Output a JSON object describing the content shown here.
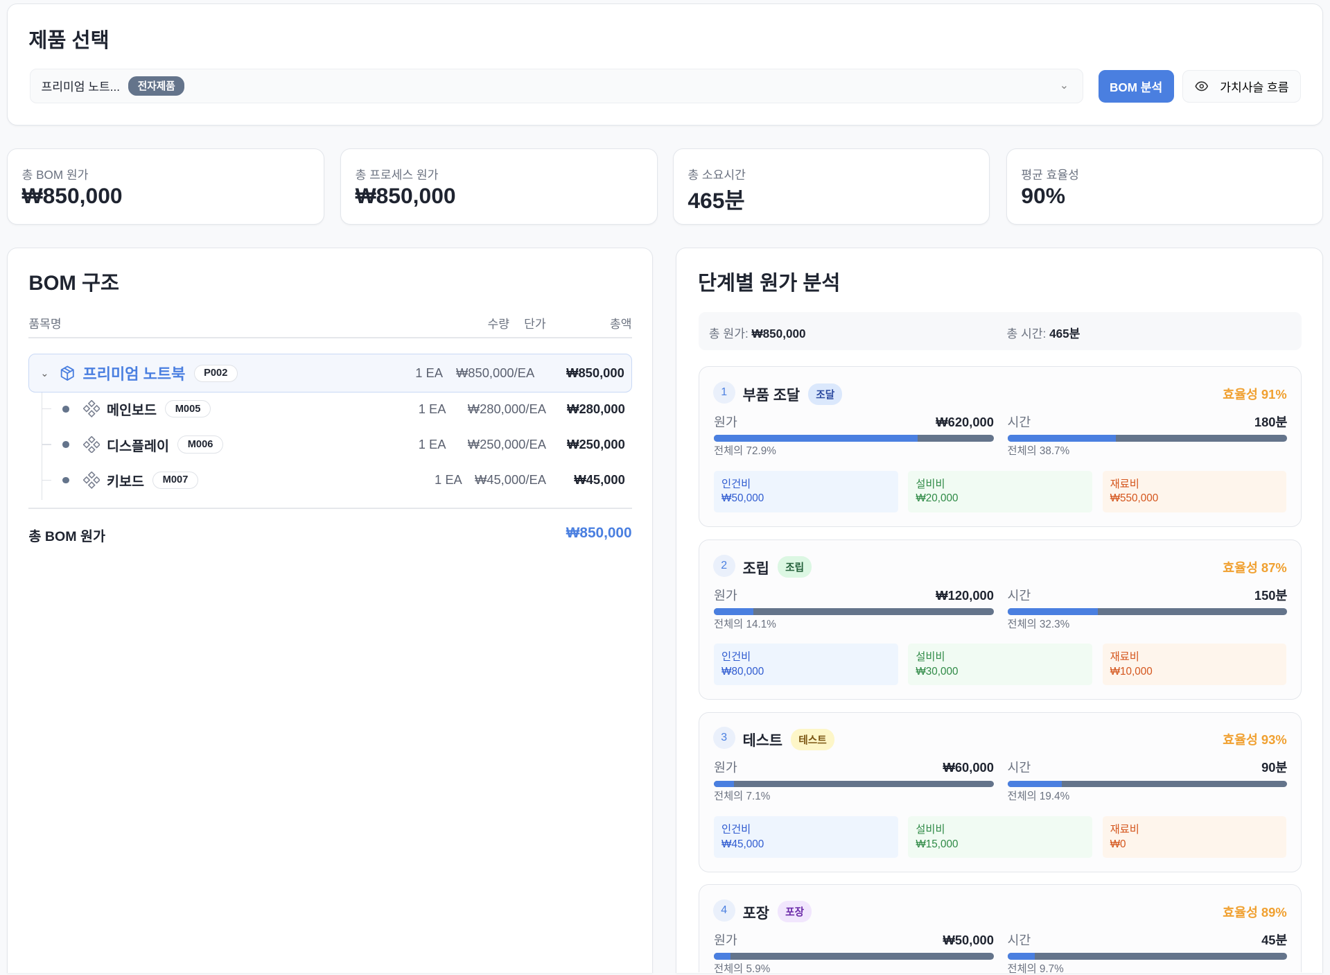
{
  "product_select": {
    "title": "제품 선택",
    "selected": "프리미엄 노트...",
    "category_badge": "전자제품",
    "bom_button": "BOM 분석",
    "value_chain_button": "가치사슬 흐름"
  },
  "stats": [
    {
      "label": "총 BOM 원가",
      "value": "₩850,000"
    },
    {
      "label": "총 프로세스 원가",
      "value": "₩850,000"
    },
    {
      "label": "총 소요시간",
      "value": "465분"
    },
    {
      "label": "평균 효율성",
      "value": "90%"
    }
  ],
  "bom": {
    "title": "BOM 구조",
    "headers": {
      "name": "품목명",
      "qty": "수량",
      "unit_price": "단가",
      "total": "총액"
    },
    "root": {
      "name": "프리미엄 노트북",
      "code": "P002",
      "qty": "1 EA",
      "unit_price": "₩850,000/EA",
      "total": "₩850,000"
    },
    "children": [
      {
        "name": "메인보드",
        "code": "M005",
        "qty": "1 EA",
        "unit_price": "₩280,000/EA",
        "total": "₩280,000"
      },
      {
        "name": "디스플레이",
        "code": "M006",
        "qty": "1 EA",
        "unit_price": "₩250,000/EA",
        "total": "₩250,000"
      },
      {
        "name": "키보드",
        "code": "M007",
        "qty": "1 EA",
        "unit_price": "₩45,000/EA",
        "total": "₩45,000"
      }
    ],
    "footer_label": "총 BOM 원가",
    "footer_value": "₩850,000"
  },
  "stage_analysis": {
    "title": "단계별 원가 분석",
    "total_cost_label": "총 원가:",
    "total_cost": "₩850,000",
    "total_time_label": "총 시간:",
    "total_time": "465분",
    "cost_label": "원가",
    "time_label": "시간",
    "labor_label": "인건비",
    "equipment_label": "설비비",
    "material_label": "재료비",
    "stages": [
      {
        "num": "1",
        "name": "부품 조달",
        "tag": "조달",
        "tag_bg": "#dbe8fc",
        "tag_fg": "#2c4aa0",
        "efficiency": "효율성 91%",
        "cost": "₩620,000",
        "cost_pct": 72.9,
        "cost_pct_text": "전체의 72.9%",
        "time": "180분",
        "time_pct": 38.7,
        "time_pct_text": "전체의 38.7%",
        "labor": "₩50,000",
        "equipment": "₩20,000",
        "material": "₩550,000"
      },
      {
        "num": "2",
        "name": "조립",
        "tag": "조립",
        "tag_bg": "#dcf7e3",
        "tag_fg": "#23603a",
        "efficiency": "효율성 87%",
        "cost": "₩120,000",
        "cost_pct": 14.1,
        "cost_pct_text": "전체의 14.1%",
        "time": "150분",
        "time_pct": 32.3,
        "time_pct_text": "전체의 32.3%",
        "labor": "₩80,000",
        "equipment": "₩30,000",
        "material": "₩10,000"
      },
      {
        "num": "3",
        "name": "테스트",
        "tag": "테스트",
        "tag_bg": "#fdf6c8",
        "tag_fg": "#7a5512",
        "efficiency": "효율성 93%",
        "cost": "₩60,000",
        "cost_pct": 7.1,
        "cost_pct_text": "전체의 7.1%",
        "time": "90분",
        "time_pct": 19.4,
        "time_pct_text": "전체의 19.4%",
        "labor": "₩45,000",
        "equipment": "₩15,000",
        "material": "₩0"
      },
      {
        "num": "4",
        "name": "포장",
        "tag": "포장",
        "tag_bg": "#f1e6fd",
        "tag_fg": "#6b2aa8",
        "efficiency": "효율성 89%",
        "cost": "₩50,000",
        "cost_pct": 5.9,
        "cost_pct_text": "전체의 5.9%",
        "time": "45분",
        "time_pct": 9.7,
        "time_pct_text": "전체의 9.7%",
        "labor": "",
        "equipment": "",
        "material": ""
      }
    ]
  }
}
